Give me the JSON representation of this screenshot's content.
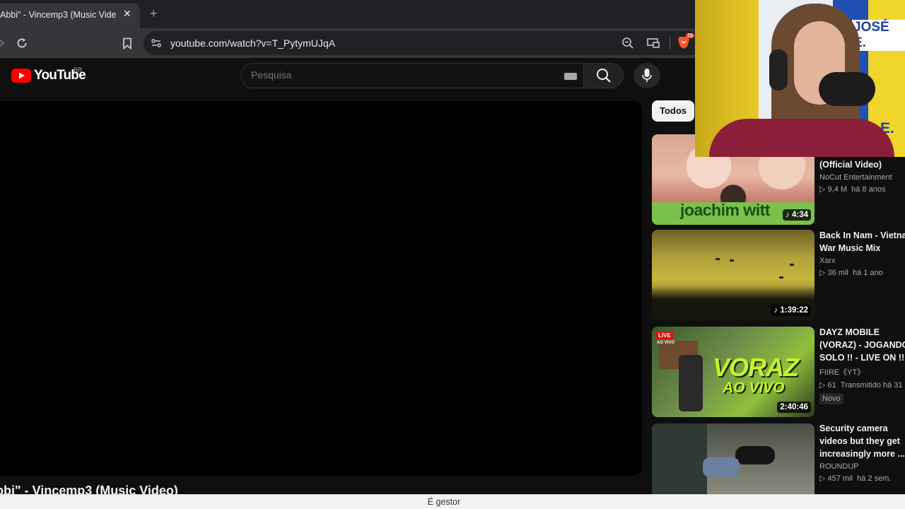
{
  "browser": {
    "tab_title": "Abbi\" - Vincemp3 (Music Video",
    "url": "youtube.com/watch?v=T_PytymUJqA",
    "extension_badge": "15"
  },
  "youtube": {
    "logo_text": "YouTube",
    "country_code": "BR",
    "search_placeholder": "Pesquisa",
    "video_title": "bbi\" - Vincemp3 (Music Video)"
  },
  "chips": {
    "todos": "Todos"
  },
  "recommendations": [
    {
      "title_lines": [
        "(Official Video)"
      ],
      "thumb_text": "joachim witt",
      "duration": "4:34",
      "channel": "NoCut Entertainment",
      "views": "9,4 M",
      "age": "há 8 anos"
    },
    {
      "title_lines": [
        "Back In Nam - Vietnam",
        "War Music Mix"
      ],
      "duration": "1:39:22",
      "channel": "Xarx",
      "views": "36 mil",
      "age": "há 1 ano"
    },
    {
      "title_lines": [
        "DAYZ MOBILE",
        "(VORAZ) - JOGANDO",
        "SOLO !! - LIVE ON !!"
      ],
      "thumb_text_1": "VORAZ",
      "thumb_text_2": "AO VIVO",
      "live_badge": "LIVE",
      "live_sub": "AO VIVO",
      "duration": "2:40:46",
      "channel": "FIIRE《YT》",
      "views": "61",
      "age": "Transmitido há 31",
      "badge": "Novo"
    },
    {
      "title_lines": [
        "Security camera",
        "videos but they get",
        "increasingly more ..."
      ],
      "channel": "ROUNDUP",
      "views": "457 mil",
      "age": "há 2 sem."
    }
  ],
  "webcam_overlay": {
    "flag_text_1": "JOSÉ E.",
    "flag_text_2": "E."
  },
  "status_bar": {
    "text": "É gestor"
  },
  "colors": {
    "yt_red": "#ff0000",
    "background": "#0f0f0f",
    "brave_orange": "#fb542b"
  }
}
